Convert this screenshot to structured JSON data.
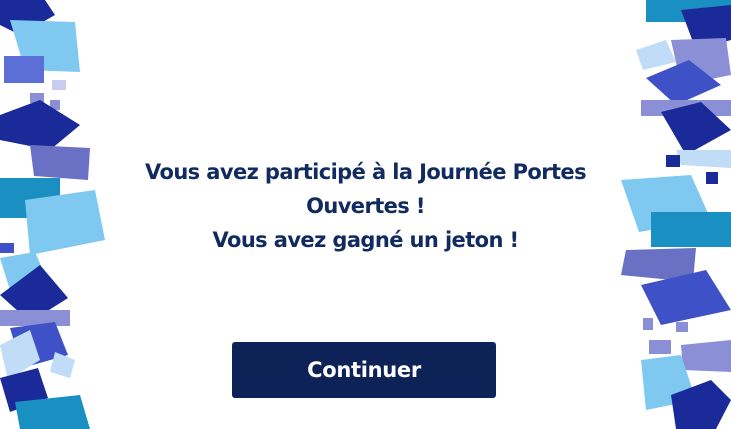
{
  "message": {
    "line1": "Vous avez participé à la Journée Portes",
    "line2": "Ouvertes !",
    "line3": "Vous avez gagné un jeton !"
  },
  "button": {
    "label": "Continuer"
  },
  "colors": {
    "text": "#112a5f",
    "button": "#0d2257",
    "button_text": "#ffffff",
    "deco_navy": "#1a2a99",
    "deco_blue": "#3f51c7",
    "deco_sky": "#7fc8f0",
    "deco_teal": "#1a8fc2",
    "deco_lilac": "#8a8fd6"
  }
}
